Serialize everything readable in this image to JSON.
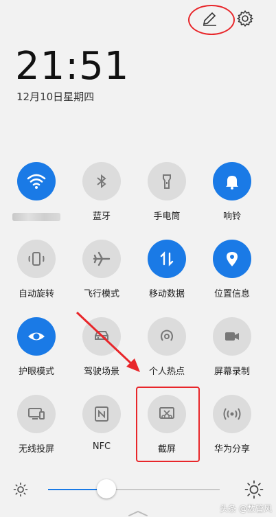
{
  "status": {
    "time": "21:51",
    "date": "12月10日星期四"
  },
  "header": {
    "edit_icon": "pencil-icon",
    "settings_icon": "gear-icon"
  },
  "tiles": [
    {
      "label": "",
      "icon": "wifi-icon",
      "state": "on"
    },
    {
      "label": "蓝牙",
      "icon": "bluetooth-icon",
      "state": "off"
    },
    {
      "label": "手电筒",
      "icon": "flashlight-icon",
      "state": "off"
    },
    {
      "label": "响铃",
      "icon": "bell-icon",
      "state": "on"
    },
    {
      "label": "自动旋转",
      "icon": "rotate-icon",
      "state": "off"
    },
    {
      "label": "飞行模式",
      "icon": "airplane-icon",
      "state": "off"
    },
    {
      "label": "移动数据",
      "icon": "mobile-data-icon",
      "state": "on"
    },
    {
      "label": "位置信息",
      "icon": "location-icon",
      "state": "on"
    },
    {
      "label": "护眼模式",
      "icon": "eye-icon",
      "state": "on"
    },
    {
      "label": "驾驶场景",
      "icon": "car-icon",
      "state": "off"
    },
    {
      "label": "个人热点",
      "icon": "hotspot-icon",
      "state": "off"
    },
    {
      "label": "屏幕录制",
      "icon": "screen-record-icon",
      "state": "off"
    },
    {
      "label": "无线投屏",
      "icon": "wireless-projection-icon",
      "state": "off"
    },
    {
      "label": "NFC",
      "icon": "nfc-icon",
      "state": "off"
    },
    {
      "label": "截屏",
      "icon": "screenshot-icon",
      "state": "off"
    },
    {
      "label": "华为分享",
      "icon": "huawei-share-icon",
      "state": "off"
    }
  ],
  "brightness": {
    "level": 0.34,
    "low_icon": "sun-small-icon",
    "high_icon": "sun-large-icon"
  },
  "watermark": "头条 @数管风",
  "colors": {
    "accent": "#1a7ae6",
    "tile_off": "#dcdcdc",
    "annotation": "#e8262a"
  }
}
